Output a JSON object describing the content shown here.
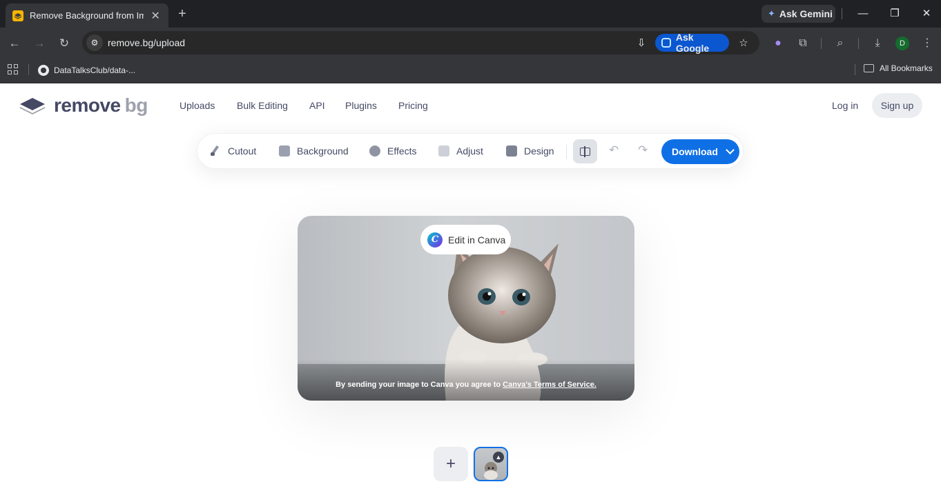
{
  "browser": {
    "tab_title": "Remove Background from Imag",
    "tab_close": "✕",
    "new_tab": "+",
    "ask_gemini": "Ask Gemini",
    "url": "remove.bg/upload",
    "ask_google": "Ask Google",
    "bookmark_1": "DataTalksClub/data-...",
    "all_bookmarks": "All Bookmarks",
    "profile_initial": "D",
    "window_controls": {
      "minimize": "—",
      "restore": "❐",
      "close": "✕"
    }
  },
  "site": {
    "logo_remove": "remove",
    "logo_bg": "bg",
    "nav": [
      "Uploads",
      "Bulk Editing",
      "API",
      "Plugins",
      "Pricing"
    ],
    "login": "Log in",
    "signup": "Sign up"
  },
  "editor": {
    "tools": [
      "Cutout",
      "Background",
      "Effects",
      "Adjust",
      "Design"
    ],
    "download": "Download",
    "edit_in_canva": "Edit in Canva",
    "terms_prefix": "By sending your image to Canva you agree to ",
    "terms_link": "Canva's Terms of Service.",
    "add_label": "+"
  },
  "colors": {
    "accent": "#0f70e6",
    "chrome_dark": "#202124",
    "chrome_toolbar": "#35363a",
    "text": "#454964"
  }
}
